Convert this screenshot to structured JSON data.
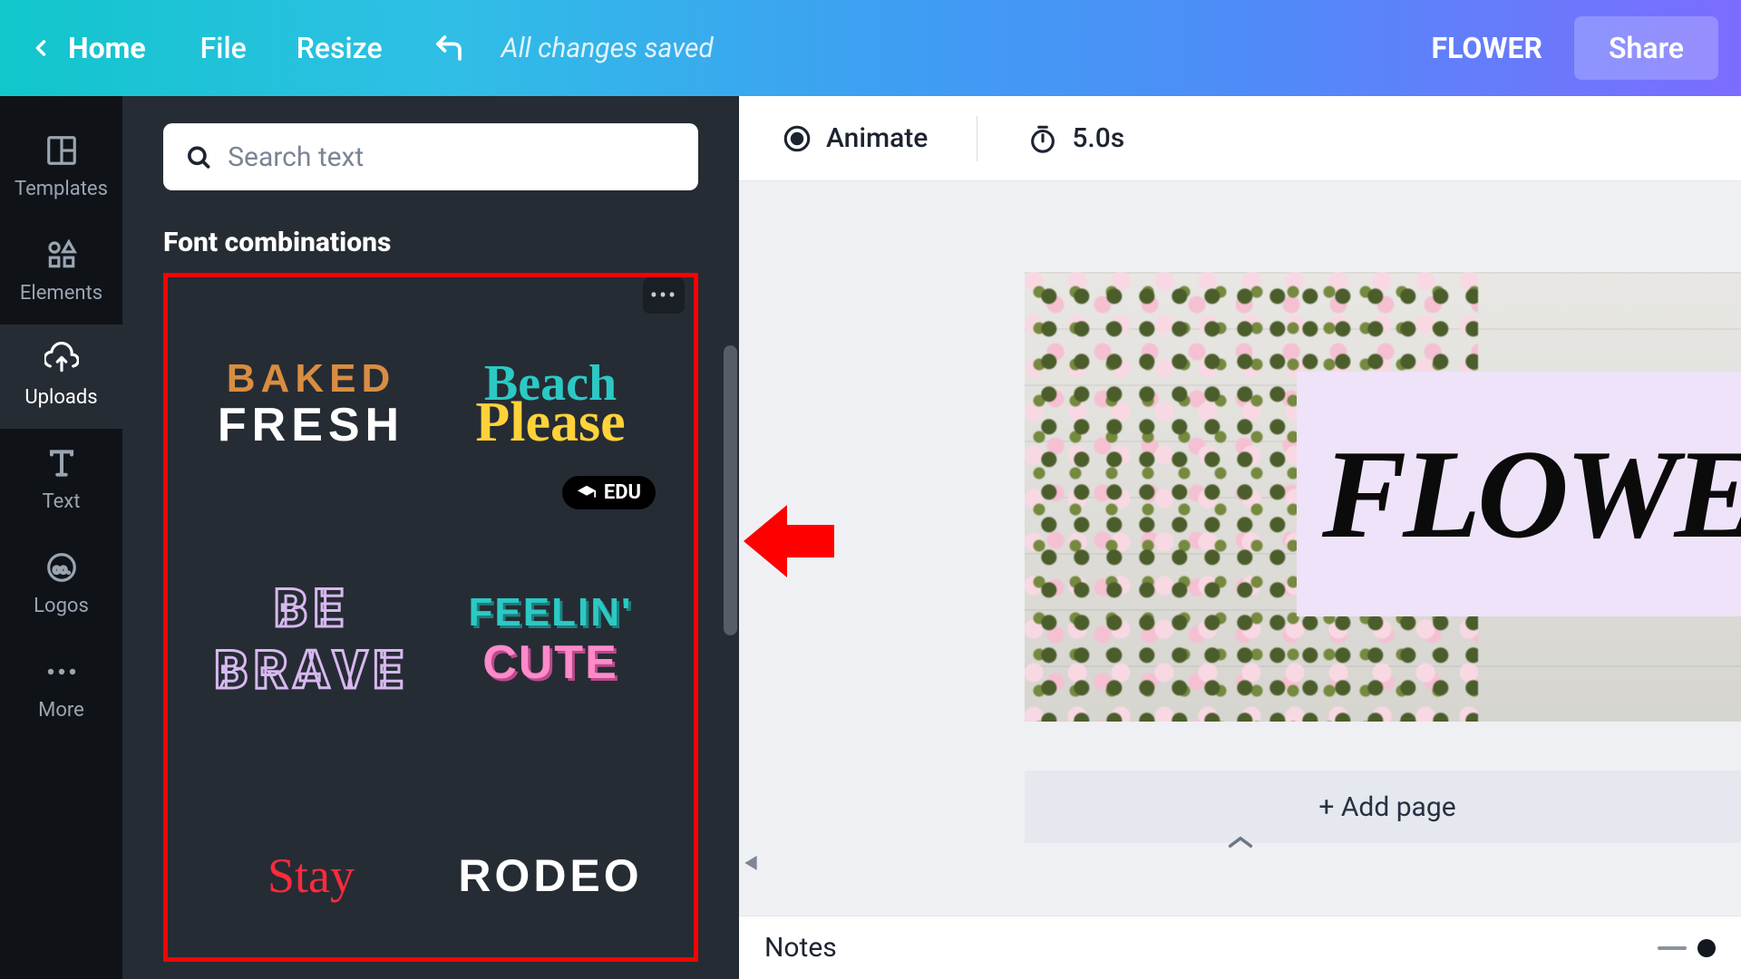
{
  "topbar": {
    "home": "Home",
    "file": "File",
    "resize": "Resize",
    "saved": "All changes saved",
    "doc_title": "FLOWER",
    "share": "Share"
  },
  "rail": {
    "templates": "Templates",
    "elements": "Elements",
    "uploads": "Uploads",
    "text": "Text",
    "logos": "Logos",
    "more": "More"
  },
  "panel": {
    "search_placeholder": "Search text",
    "section_title": "Font combinations",
    "edu_badge": "EDU",
    "cards": {
      "c1": {
        "l1": "BAKED",
        "l2": "FRESH"
      },
      "c2": {
        "l1": "Beach",
        "l2": "Please"
      },
      "c3": {
        "l1": "BE",
        "l2": "BRAVE"
      },
      "c4": {
        "l1": "FEELIN'",
        "l2": "CUTE"
      },
      "c5": {
        "l1": "Stay"
      },
      "c6": {
        "l1": "RODEO"
      }
    }
  },
  "tools": {
    "animate": "Animate",
    "duration": "5.0s"
  },
  "canvas": {
    "text": "FLOWER",
    "add_page": "+ Add page"
  },
  "bottom": {
    "notes": "Notes"
  }
}
